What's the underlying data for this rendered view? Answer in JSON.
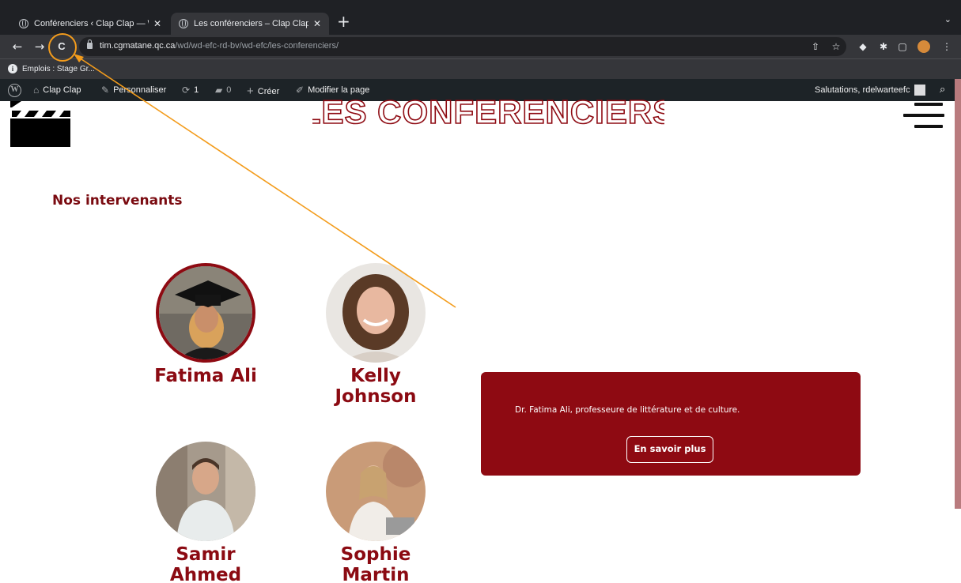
{
  "browser": {
    "tabs": [
      {
        "title": "Conférenciers ‹ Clap Clap — W",
        "active": false
      },
      {
        "title": "Les conférenciers – Clap Clap",
        "active": true
      }
    ],
    "close_glyph": "✕",
    "new_tab_glyph": "+",
    "tab_menu_glyph": "⌄",
    "url_host": "tim.cgmatane.qc.ca",
    "url_path": "/wd/wd-efc-rd-bv/wd-efc/les-conferenciers/",
    "nav": {
      "back": "←",
      "forward": "→",
      "reload": "C"
    },
    "bookmark": {
      "label": "Emplois : Stage Gr..."
    },
    "extension_icons": [
      "share-icon",
      "star-icon",
      "shield-icon",
      "puzzle-icon",
      "sidepanel-icon",
      "profile-icon",
      "kebab-menu-icon"
    ]
  },
  "adminbar": {
    "site_name": "Clap Clap",
    "customize": "Personnaliser",
    "updates_count": "1",
    "comments_count": "0",
    "new_label": "Créer",
    "edit_label": "Modifier la page",
    "greeting": "Salutations, rdelwarteefc"
  },
  "page": {
    "title": "LES CONFERENCIERS",
    "section_title": "Nos intervenants",
    "speakers": [
      {
        "name_line1": "Fatima Ali",
        "name_line2": "",
        "selected": true
      },
      {
        "name_line1": "Kelly",
        "name_line2": "Johnson",
        "selected": false
      },
      {
        "name_line1": "Samir",
        "name_line2": "Ahmed",
        "selected": false
      },
      {
        "name_line1": "Sophie",
        "name_line2": "Martin",
        "selected": false
      }
    ],
    "info_card": {
      "description": "Dr. Fatima Ali, professeure de littérature et de culture.",
      "button_label": "En savoir plus"
    }
  },
  "colors": {
    "accent": "#8e0a12",
    "annotation": "#f39c1c",
    "chrome_dark": "#1f2125",
    "adminbar": "#1d2327"
  }
}
